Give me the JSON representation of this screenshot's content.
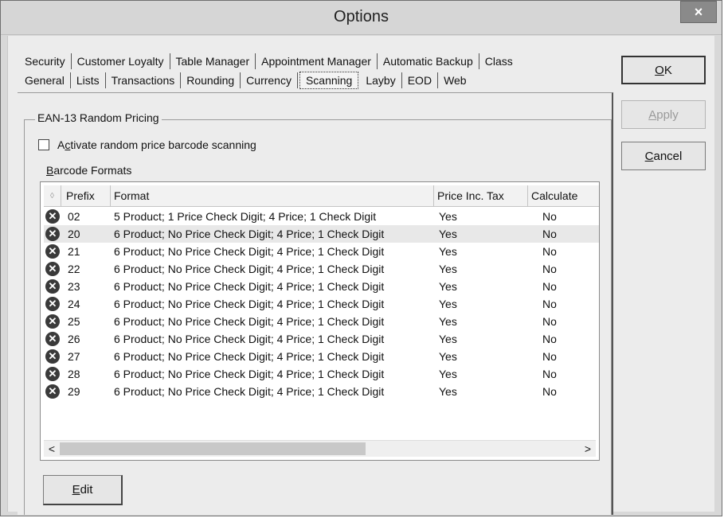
{
  "window": {
    "title": "Options",
    "close_label": "×"
  },
  "tabs": {
    "row1": [
      "Security",
      "Customer Loyalty",
      "Table Manager",
      "Appointment Manager",
      "Automatic Backup",
      "Class"
    ],
    "row2": [
      "General",
      "Lists",
      "Transactions",
      "Rounding",
      "Currency",
      "Scanning",
      "Layby",
      "EOD",
      "Web"
    ],
    "active": "Scanning"
  },
  "group": {
    "legend": "EAN-13 Random Pricing"
  },
  "checkbox": {
    "label_pre": "A",
    "label_hot": "c",
    "label_post": "tivate random price barcode scanning",
    "checked": false
  },
  "formats_label": {
    "hot": "B",
    "rest": "arcode Formats"
  },
  "grid": {
    "header": {
      "icon": "◊",
      "prefix": "Prefix",
      "format": "Format",
      "price": "Price Inc. Tax",
      "calc": "Calculate"
    },
    "rows": [
      {
        "prefix": "02",
        "format": "5 Product; 1 Price Check Digit; 4 Price; 1 Check Digit",
        "price": "Yes",
        "calc": "No"
      },
      {
        "prefix": "20",
        "format": "6 Product; No Price Check Digit; 4 Price; 1 Check Digit",
        "price": "Yes",
        "calc": "No"
      },
      {
        "prefix": "21",
        "format": "6 Product; No Price Check Digit; 4 Price; 1 Check Digit",
        "price": "Yes",
        "calc": "No"
      },
      {
        "prefix": "22",
        "format": "6 Product; No Price Check Digit; 4 Price; 1 Check Digit",
        "price": "Yes",
        "calc": "No"
      },
      {
        "prefix": "23",
        "format": "6 Product; No Price Check Digit; 4 Price; 1 Check Digit",
        "price": "Yes",
        "calc": "No"
      },
      {
        "prefix": "24",
        "format": "6 Product; No Price Check Digit; 4 Price; 1 Check Digit",
        "price": "Yes",
        "calc": "No"
      },
      {
        "prefix": "25",
        "format": "6 Product; No Price Check Digit; 4 Price; 1 Check Digit",
        "price": "Yes",
        "calc": "No"
      },
      {
        "prefix": "26",
        "format": "6 Product; No Price Check Digit; 4 Price; 1 Check Digit",
        "price": "Yes",
        "calc": "No"
      },
      {
        "prefix": "27",
        "format": "6 Product; No Price Check Digit; 4 Price; 1 Check Digit",
        "price": "Yes",
        "calc": "No"
      },
      {
        "prefix": "28",
        "format": "6 Product; No Price Check Digit; 4 Price; 1 Check Digit",
        "price": "Yes",
        "calc": "No"
      },
      {
        "prefix": "29",
        "format": "6 Product; No Price Check Digit; 4 Price; 1 Check Digit",
        "price": "Yes",
        "calc": "No"
      }
    ],
    "row_icon": "delete-circle-icon",
    "scroll_left": "<",
    "scroll_right": ">"
  },
  "buttons": {
    "ok": {
      "hot": "O",
      "rest": "K"
    },
    "apply": {
      "hot": "A",
      "rest": "pply"
    },
    "cancel": {
      "hot": "C",
      "rest": "ancel"
    },
    "edit": {
      "hot": "E",
      "rest": "dit"
    }
  }
}
